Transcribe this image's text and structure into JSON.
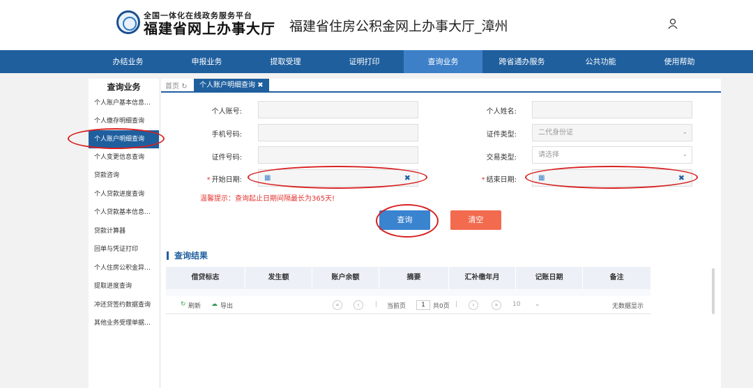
{
  "header": {
    "logo_top": "全国一体化在线政务服务平台",
    "logo_main": "福建省网上办事大厅",
    "site_title": "福建省住房公积金网上办事大厅_漳州",
    "user_icon": "user-icon"
  },
  "nav": {
    "items": [
      "办结业务",
      "申报业务",
      "提取受理",
      "证明打印",
      "查询业务",
      "跨省通办服务",
      "公共功能",
      "使用帮助"
    ],
    "active_index": 4
  },
  "sidebar": {
    "title": "查询业务",
    "items": [
      "个人账户基本信息…",
      "个人缴存明细查询",
      "个人账户明细查询",
      "个人变更信息查询",
      "贷款咨询",
      "个人贷款进度查询",
      "个人贷款基本信息…",
      "贷款计算器",
      "回单与凭证打印",
      "个人住房公积金异…",
      "提取进度查询",
      "冲还贷签约数据查询",
      "其他业务受理单据…"
    ],
    "active_index": 2
  },
  "tabs": {
    "home": "首页",
    "home_icon": "refresh-icon",
    "active": "个人账户明细查询",
    "close_icon": "close-icon"
  },
  "form": {
    "account_label": "个人账号:",
    "name_label": "个人姓名:",
    "phone_label": "手机号码:",
    "id_type_label": "证件类型:",
    "id_type_value": "二代身份证",
    "id_no_label": "证件号码:",
    "trade_type_label": "交易类型:",
    "trade_type_placeholder": "请选择",
    "start_label": "开始日期:",
    "end_label": "结束日期:",
    "required_mark": "*",
    "calendar_icon": "calendar-icon",
    "clear_icon": "clear-icon",
    "tip": "温馨提示：查询起止日期间隔最长为365天!",
    "query_button": "查询",
    "clear_button": "清空"
  },
  "results": {
    "title": "查询结果",
    "columns": [
      "借贷标志",
      "发生额",
      "账户余额",
      "摘要",
      "汇补缴年月",
      "记账日期",
      "备注"
    ],
    "refresh": "刷新",
    "export": "导出",
    "current_page_label": "当前页",
    "current_page": "1",
    "total_pages": "共0页",
    "page_size": "10",
    "no_data": "无数据显示"
  },
  "colors": {
    "nav_bg": "#1f5f9e",
    "nav_active": "#3d80c8",
    "annotation": "#d82020",
    "required": "#e0332e",
    "clear_button": "#f26b4f"
  }
}
